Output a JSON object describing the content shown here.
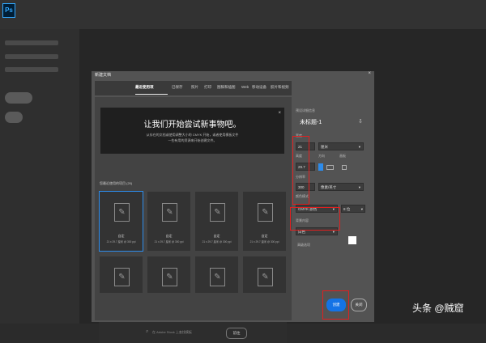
{
  "app": {
    "logo_text": "Ps"
  },
  "dialog": {
    "title": "新建文档",
    "close_glyph": "×",
    "tabs": [
      "最近使用项",
      "已保存",
      "照片",
      "打印",
      "图稿和插图",
      "Web",
      "移动设备",
      "胶片和视频"
    ],
    "hero": {
      "title": "让我们开始尝试新事物吧。",
      "subtitle_line1": "从存在的文档或使用调整大小的 CMYK 开始，或者使用模板文件",
      "subtitle_line2": "一些有用的资源来开始创建文件。"
    },
    "recent_label": "您最近使用的项目 (20)",
    "cards": [
      {
        "name": "自定",
        "meta": "21 x 29.7 厘米 @ 300 ppi"
      },
      {
        "name": "自定",
        "meta": "21 x 29.7 厘米 @ 300 ppi"
      },
      {
        "name": "自定",
        "meta": "21 x 29.7 厘米 @ 300 ppi"
      },
      {
        "name": "自定",
        "meta": "21 x 29.7 厘米 @ 300 ppi"
      },
      {
        "name": "",
        "meta": ""
      },
      {
        "name": "",
        "meta": ""
      },
      {
        "name": "",
        "meta": ""
      },
      {
        "name": "",
        "meta": ""
      }
    ],
    "search": {
      "placeholder": "在 Adobe Stock 上查找模板",
      "button": "前往"
    },
    "details": {
      "section_label": "预设详细信息",
      "doc_name": "未标题-1",
      "width_label": "宽度",
      "width_value": "21",
      "width_unit": "厘米",
      "height_label": "高度",
      "height_value": "29.7",
      "orientation_label": "方向",
      "artboard_label": "画板",
      "resolution_label": "分辨率",
      "resolution_value": "300",
      "resolution_unit": "像素/英寸",
      "color_mode_label": "颜色模式",
      "color_mode_value": "CMYK 颜色",
      "bit_depth": "8 位",
      "background_label": "背景内容",
      "background_value": "白色",
      "advanced_label": "高级选项"
    },
    "buttons": {
      "create": "创建",
      "close": "关闭"
    }
  },
  "watermark": "头条 @贼窟"
}
